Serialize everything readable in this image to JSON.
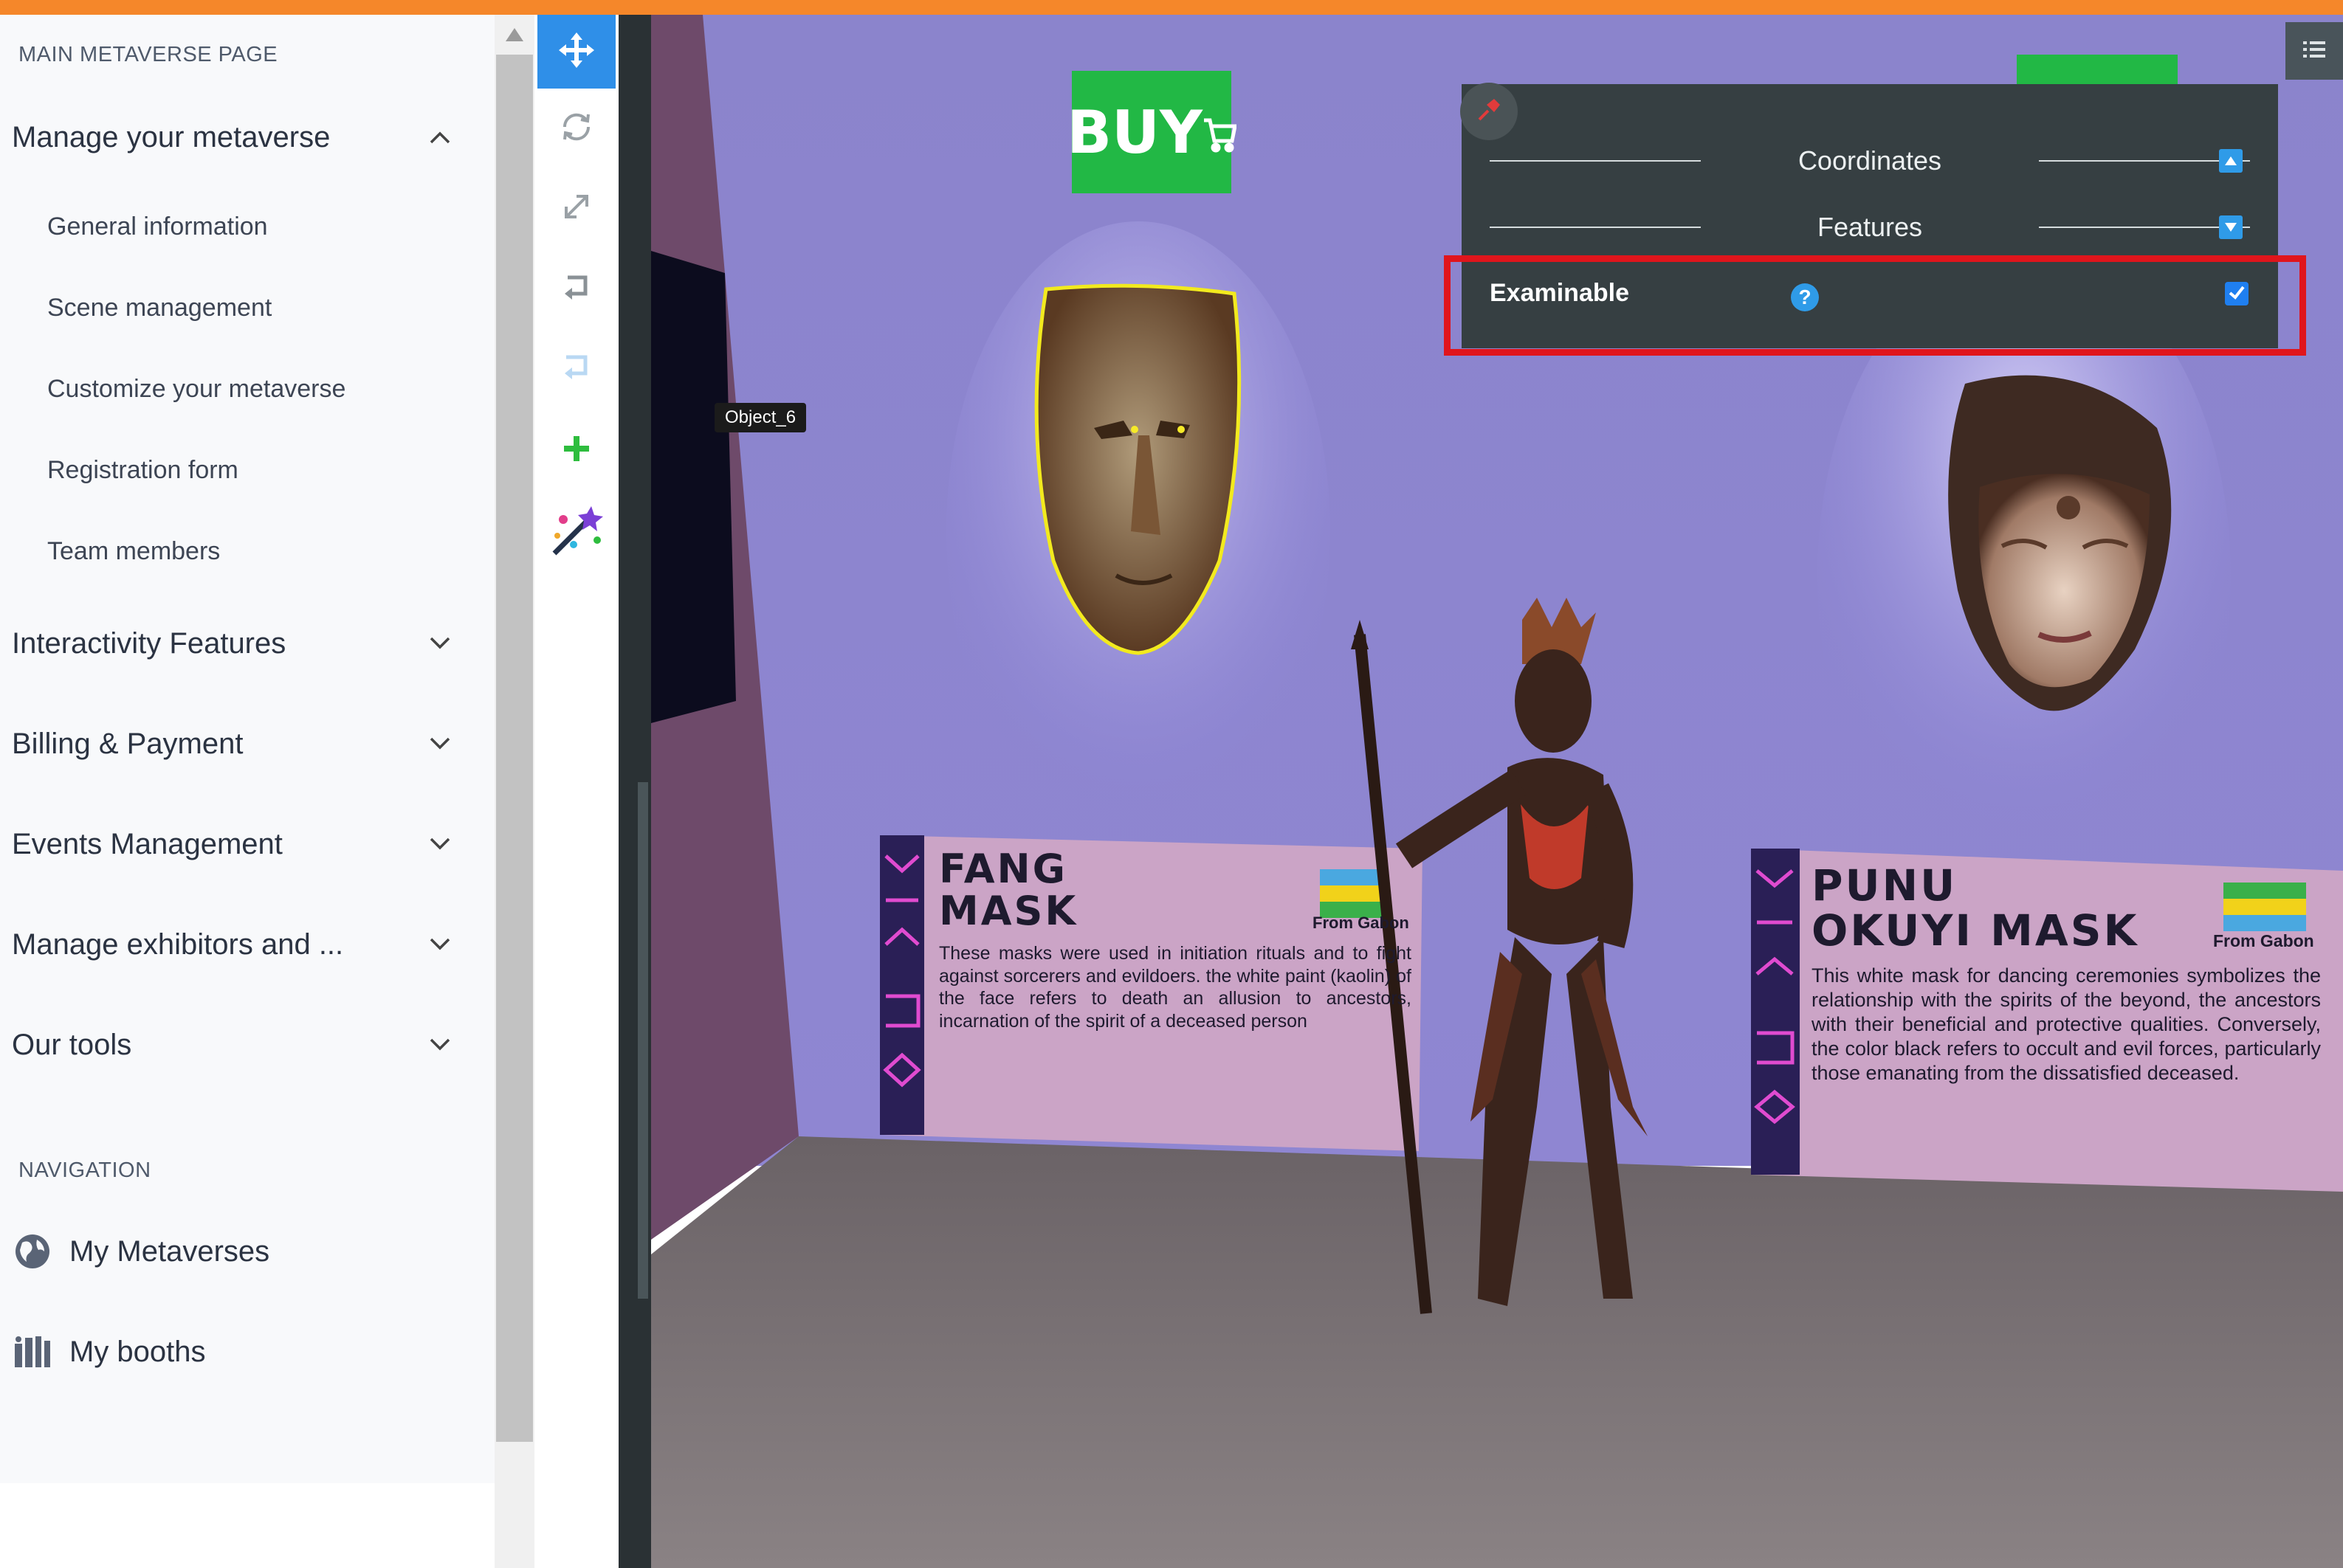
{
  "sidebar": {
    "section_title": "MAIN METAVERSE PAGE",
    "groups": [
      {
        "label": "Manage your metaverse",
        "expanded": true
      },
      {
        "label": "Interactivity Features",
        "expanded": false
      },
      {
        "label": "Billing & Payment",
        "expanded": false
      },
      {
        "label": "Events Management",
        "expanded": false
      },
      {
        "label": "Manage exhibitors and ...",
        "expanded": false
      },
      {
        "label": "Our tools",
        "expanded": false
      }
    ],
    "submenu": [
      {
        "label": "General information"
      },
      {
        "label": "Scene management"
      },
      {
        "label": "Customize your metaverse"
      },
      {
        "label": "Registration form"
      },
      {
        "label": "Team members"
      }
    ],
    "nav_title": "NAVIGATION",
    "nav": [
      {
        "label": "My Metaverses",
        "icon": "globe-icon"
      },
      {
        "label": "My booths",
        "icon": "booths-icon"
      }
    ]
  },
  "toolbar": {
    "tools": [
      "move-tool",
      "rotate-tool",
      "scale-tool",
      "return-tool",
      "undo-tool",
      "add-tool",
      "magic-tool"
    ],
    "active_tool": "move-tool",
    "accent": "#2f8fe8"
  },
  "scene": {
    "object_label": "Object_6",
    "buy_sign": "BUY",
    "plaque_left": {
      "title_line1": "FANG",
      "title_line2": "MASK",
      "origin": "From Gabon",
      "text": "These masks were used in initiation rituals and to fight against sorcerers and evildoers. the white paint (kaolin) of the face refers to death an allusion to ancestors, incarnation of the spirit of a deceased person"
    },
    "plaque_right": {
      "title_line1": "PUNU",
      "title_line2": "OKUYI MASK",
      "origin": "From Gabon",
      "text": "This white mask for dancing ceremonies symbolizes the relationship with the spirits of the beyond, the ancestors with their beneficial and protective qualities. Conversely, the color black refers to occult and evil forces, particularly those emanating from the dissatisfied deceased."
    }
  },
  "panel": {
    "coordinates_label": "Coordinates",
    "features_label": "Features",
    "examinable_label": "Examinable",
    "help_symbol": "?",
    "examinable_checked": true,
    "highlight_color": "#e0151c"
  },
  "colors": {
    "top_accent": "#f5872a",
    "panel_bg": "#363f42",
    "checkbox_blue": "#1f7ff0",
    "buy_green": "#22b845"
  }
}
